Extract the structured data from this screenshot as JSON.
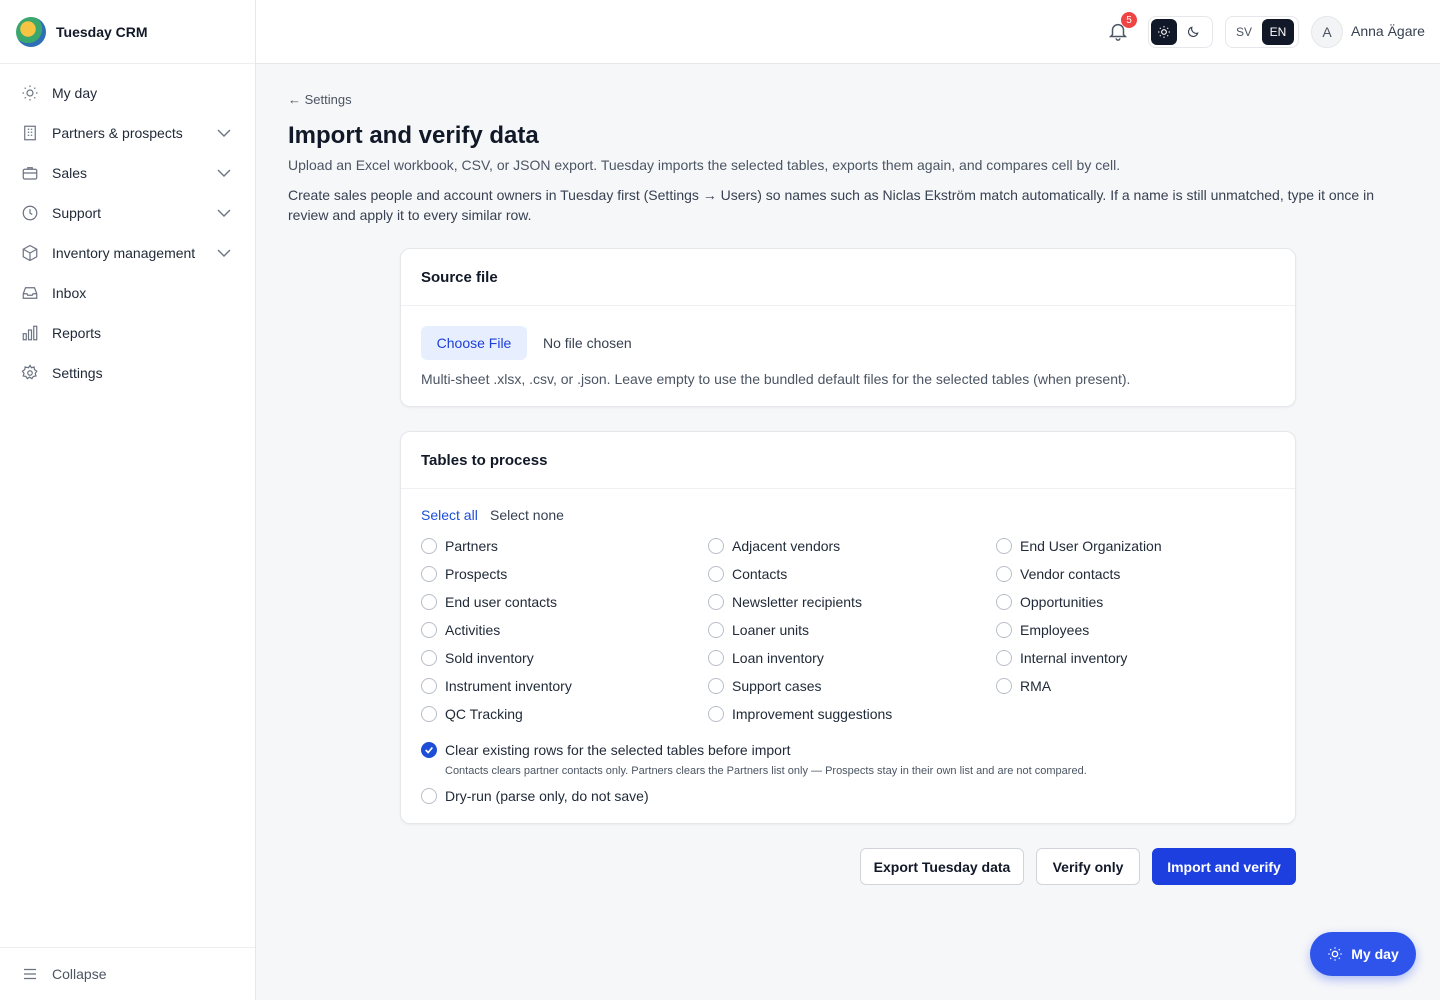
{
  "app": {
    "name": "Tuesday CRM"
  },
  "sidebar": {
    "items": [
      {
        "label": "My day",
        "icon": "sun-icon"
      },
      {
        "label": "Partners & prospects",
        "icon": "building-icon"
      },
      {
        "label": "Sales",
        "icon": "briefcase-icon"
      },
      {
        "label": "Support",
        "icon": "lifebuoy-icon"
      },
      {
        "label": "Inventory management",
        "icon": "box-icon"
      },
      {
        "label": "Inbox",
        "icon": "inbox-icon"
      },
      {
        "label": "Reports",
        "icon": "bar-chart-icon"
      },
      {
        "label": "Settings",
        "icon": "gear-icon"
      }
    ],
    "collapse_label": "Collapse"
  },
  "topbar": {
    "notification_count": "5",
    "lang_sv": "SV",
    "lang_en": "EN",
    "avatar_initial": "A",
    "user_name": "Anna Ägare"
  },
  "page": {
    "back_label": "← Settings",
    "title": "Import and verify data",
    "intro": "Upload an Excel workbook, CSV, or JSON export. Tuesday imports the selected tables, exports them again, and compares cell by cell.",
    "note": "Create sales people and account owners in Tuesday first (Settings → Users) so names such as Niclas Ekström match automatically. If a name is still unmatched, type it once in review and apply it to every similar row."
  },
  "source_card": {
    "title": "Source file",
    "choose_label": "Choose File",
    "no_file_label": "No file chosen",
    "hint": "Multi-sheet .xlsx, .csv, or .json. Leave empty to use the bundled default files for the selected tables (when present)."
  },
  "tables_card": {
    "title": "Tables to process",
    "select_all": "Select all",
    "select_none": "Select none",
    "col1": [
      "Partners",
      "Prospects",
      "End user contacts",
      "Activities",
      "Sold inventory",
      "Instrument inventory",
      "QC Tracking"
    ],
    "col2": [
      "Adjacent vendors",
      "Contacts",
      "Newsletter recipients",
      "Loaner units",
      "Loan inventory",
      "Support cases",
      "Improvement suggestions"
    ],
    "col3": [
      "End User Organization",
      "Vendor contacts",
      "Opportunities",
      "Employees",
      "Internal inventory",
      "RMA"
    ],
    "clear_rows_label": "Clear existing rows for the selected tables before import",
    "clear_rows_checked": true,
    "clear_rows_sub": "Contacts clears partner contacts only. Partners clears the Partners list only — Prospects stay in their own list and are not compared.",
    "dry_run_label": "Dry-run (parse only, do not save)"
  },
  "actions": {
    "export_label": "Export Tuesday data",
    "verify_label": "Verify only",
    "import_label": "Import and verify"
  },
  "fab": {
    "label": "My day"
  },
  "colors": {
    "accent": "#1d3fe0",
    "badge": "#ef4444",
    "dark": "#111827"
  }
}
